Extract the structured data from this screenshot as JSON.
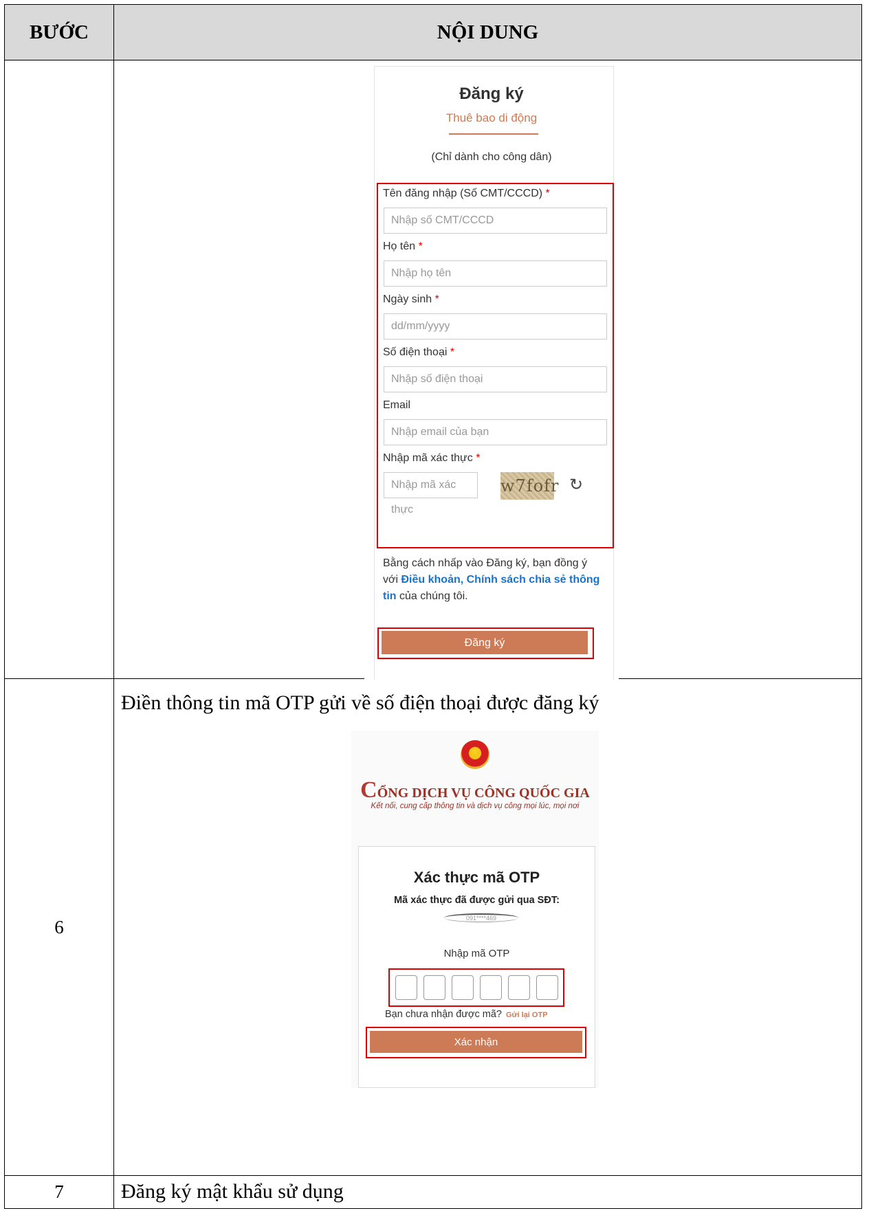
{
  "table": {
    "col_step": "BƯỚC",
    "col_content": "NỘI DUNG"
  },
  "register_form": {
    "title": "Đăng ký",
    "tab": "Thuê bao di động",
    "note": "(Chỉ dành cho công dân)",
    "fields": [
      {
        "label": "Tên đăng nhập (Số CMT/CCCD)",
        "required": "*",
        "placeholder": "Nhập số CMT/CCCD"
      },
      {
        "label": "Họ tên",
        "required": "*",
        "placeholder": "Nhập họ tên"
      },
      {
        "label": "Ngày sinh",
        "required": "*",
        "placeholder": "dd/mm/yyyy"
      },
      {
        "label": "Số điện thoại",
        "required": "*",
        "placeholder": "Nhập số điện thoại"
      },
      {
        "label": "Email",
        "required": "",
        "placeholder": "Nhập email của bạn"
      }
    ],
    "captcha": {
      "label": "Nhập mã xác thực",
      "required": "*",
      "placeholder": "Nhập mã xác thực",
      "image_text": "w7fofr",
      "refresh_icon": "refresh-icon"
    },
    "terms_prefix": "Bằng cách nhấp vào Đăng ký, bạn đồng ý với",
    "terms_link": "Điều khoản, Chính sách chia sẻ thông tin",
    "terms_suffix": "của chúng tôi.",
    "submit": "Đăng ký"
  },
  "step6": {
    "number": "6",
    "description": "Điền thông tin mã OTP gửi về số điện thoại được đăng ký",
    "brand_first": "C",
    "brand_rest": "ỔNG DỊCH VỤ CÔNG QUỐC GIA",
    "tagline": "Kết nối, cung cấp thông tin và dịch vụ công mọi lúc, mọi nơi",
    "otp_title": "Xác thực mã OTP",
    "otp_sub": "Mã xác thực đã được gửi qua SĐT:",
    "otp_phone": "091****469",
    "otp_label": "Nhập mã OTP",
    "not_received": "Bạn chưa nhận được mã?",
    "resend": "Gửi lại OTP",
    "confirm": "Xác nhận",
    "emblem_icon": "national-emblem-icon"
  },
  "step7": {
    "number": "7",
    "description": "Đăng ký mật khẩu sử dụng"
  },
  "colors": {
    "accent": "#cd7a57",
    "highlight": "#e00000",
    "link": "#1a73c8",
    "brand": "#9a3226"
  }
}
